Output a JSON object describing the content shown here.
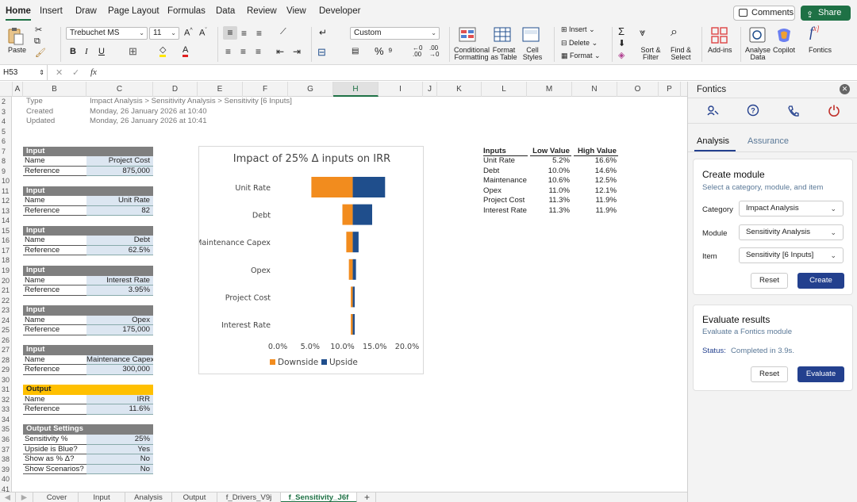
{
  "menu": [
    "Home",
    "Insert",
    "Draw",
    "Page Layout",
    "Formulas",
    "Data",
    "Review",
    "View",
    "Developer"
  ],
  "menu_active": "Home",
  "comments_label": "Comments",
  "share_label": "Share",
  "ribbon": {
    "paste": "Paste",
    "font_name": "Trebuchet MS",
    "font_size": "11",
    "number_format": "Custom",
    "conditional": [
      "Conditional",
      "Formatting"
    ],
    "format_table": [
      "Format",
      "as Table"
    ],
    "cell_styles": [
      "Cell",
      "Styles"
    ],
    "insert": "Insert",
    "delete": "Delete",
    "format": "Format",
    "sort_filter": [
      "Sort &",
      "Filter"
    ],
    "find_select": [
      "Find &",
      "Select"
    ],
    "addins": "Add-ins",
    "analyse_data": [
      "Analyse",
      "Data"
    ],
    "copilot": "Copilot",
    "fontics": "Fontics"
  },
  "formula_bar": {
    "name_box": "H53",
    "fx": "fx"
  },
  "columns": [
    "A",
    "B",
    "C",
    "D",
    "E",
    "F",
    "G",
    "H",
    "I",
    "J",
    "K",
    "L",
    "M",
    "N",
    "O",
    "P"
  ],
  "selected_column": "H",
  "rows": [
    "2",
    "3",
    "4",
    "5",
    "6",
    "7",
    "8",
    "9",
    "10",
    "11",
    "12",
    "13",
    "14",
    "15",
    "16",
    "17",
    "18",
    "19",
    "20",
    "21",
    "22",
    "23",
    "24",
    "25",
    "26",
    "27",
    "28",
    "29",
    "30",
    "31",
    "32",
    "33",
    "34",
    "35",
    "36",
    "37",
    "38",
    "39",
    "40",
    "41"
  ],
  "meta": [
    {
      "label": "Type",
      "value": "Impact Analysis > Sensitivity Analysis > Sensitivity [6 Inputs]"
    },
    {
      "label": "Created",
      "value": "Monday, 26 January 2026 at 10:40"
    },
    {
      "label": "Updated",
      "value": "Monday, 26 January 2026 at 10:41"
    }
  ],
  "input_blocks": [
    {
      "header": "Input",
      "name_label": "Name",
      "name": "Project Cost",
      "ref_label": "Reference",
      "ref": "875,000"
    },
    {
      "header": "Input",
      "name_label": "Name",
      "name": "Unit Rate",
      "ref_label": "Reference",
      "ref": "82"
    },
    {
      "header": "Input",
      "name_label": "Name",
      "name": "Debt",
      "ref_label": "Reference",
      "ref": "62.5%"
    },
    {
      "header": "Input",
      "name_label": "Name",
      "name": "Interest Rate",
      "ref_label": "Reference",
      "ref": "3.95%"
    },
    {
      "header": "Input",
      "name_label": "Name",
      "name": "Opex",
      "ref_label": "Reference",
      "ref": "175,000"
    },
    {
      "header": "Input",
      "name_label": "Name",
      "name": "Maintenance Capex",
      "ref_label": "Reference",
      "ref": "300,000"
    }
  ],
  "output_block": {
    "header": "Output",
    "name_label": "Name",
    "name": "IRR",
    "ref_label": "Reference",
    "ref": "11.6%"
  },
  "output_settings": {
    "header": "Output Settings",
    "rows": [
      {
        "label": "Sensitivity %",
        "value": "25%"
      },
      {
        "label": "Upside is Blue?",
        "value": "Yes"
      },
      {
        "label": "Show as % Δ?",
        "value": "No"
      },
      {
        "label": "Show Scenarios?",
        "value": "No"
      }
    ]
  },
  "results_table": {
    "headers": [
      "Inputs",
      "Low Value",
      "High Value"
    ],
    "rows": [
      [
        "Unit Rate",
        "5.2%",
        "16.6%"
      ],
      [
        "Debt",
        "10.0%",
        "14.6%"
      ],
      [
        "Maintenance",
        "10.6%",
        "12.5%"
      ],
      [
        "Opex",
        "11.0%",
        "12.1%"
      ],
      [
        "Project Cost",
        "11.3%",
        "11.9%"
      ],
      [
        "Interest Rate",
        "11.3%",
        "11.9%"
      ]
    ]
  },
  "chart_data": {
    "type": "bar",
    "orientation": "horizontal",
    "title": "Impact of 25% Δ inputs on IRR",
    "categories": [
      "Unit Rate",
      "Debt",
      "Maintenance Capex",
      "Opex",
      "Project Cost",
      "Interest Rate"
    ],
    "base": 11.6,
    "series": [
      {
        "name": "Downside",
        "color": "#f28c1e",
        "values": [
          5.2,
          10.0,
          10.6,
          11.0,
          11.3,
          11.3
        ]
      },
      {
        "name": "Upside",
        "color": "#1f4e8c",
        "values": [
          16.6,
          14.6,
          12.5,
          12.1,
          11.9,
          11.9
        ]
      }
    ],
    "xlim": [
      0,
      20
    ],
    "xticks": [
      "0.0%",
      "5.0%",
      "10.0%",
      "15.0%",
      "20.0%"
    ],
    "legend_position": "bottom",
    "grid": false
  },
  "sheet_tabs": [
    "Cover",
    "Input",
    "Analysis",
    "Output",
    "f_Drivers_V9j",
    "f_Sensitivity_J6f"
  ],
  "active_tab": "f_Sensitivity_J6f",
  "panel": {
    "title": "Fontics",
    "tabs": [
      "Analysis",
      "Assurance"
    ],
    "create": {
      "title": "Create module",
      "subtitle": "Select a category, module, and item",
      "category_label": "Category",
      "category_value": "Impact Analysis",
      "module_label": "Module",
      "module_value": "Sensitivity Analysis",
      "item_label": "Item",
      "item_value": "Sensitivity [6 Inputs]",
      "reset": "Reset",
      "create": "Create"
    },
    "evaluate": {
      "title": "Evaluate results",
      "subtitle": "Evaluate a Fontics module",
      "status_label": "Status:",
      "status_value": "Completed in 3.9s.",
      "reset": "Reset",
      "evaluate": "Evaluate"
    }
  },
  "colors": {
    "accent": "#1e7145",
    "primary_button": "#23408e",
    "downside": "#f28c1e",
    "upside": "#1f4e8c",
    "output_header": "#ffc000",
    "input_header": "#7f7f7f",
    "input_fill": "#dce6f1"
  }
}
